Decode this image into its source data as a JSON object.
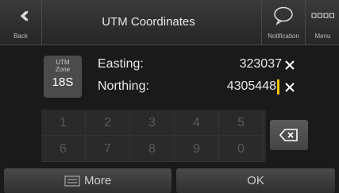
{
  "header": {
    "back_label": "Back",
    "back_icon": "double-chevron-left-icon",
    "title": "UTM Coordinates",
    "notification_label": "Notification",
    "notification_icon": "speech-bubble-icon",
    "menu_label": "Menu",
    "menu_icon": "grid-icon"
  },
  "coordinates": {
    "zone_label_line1": "UTM",
    "zone_label_line2": "Zone",
    "zone_value": "18S",
    "easting_label": "Easting:",
    "easting_value": "323037",
    "northing_label": "Northing:",
    "northing_value": "4305448",
    "clear_icon": "close-icon"
  },
  "keypad": {
    "keys": [
      "1",
      "2",
      "3",
      "4",
      "5",
      "6",
      "7",
      "8",
      "9",
      "0"
    ],
    "backspace_icon": "backspace-icon"
  },
  "footer": {
    "more_label": "More",
    "more_icon": "list-icon",
    "ok_label": "OK"
  },
  "colors": {
    "cursor": "#f5c400",
    "background": "#1a1a1a"
  }
}
